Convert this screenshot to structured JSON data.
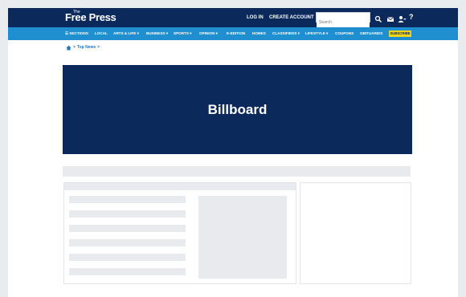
{
  "header": {
    "logo_small": "The",
    "logo_main": "Free Press",
    "login_label": "LOG IN",
    "create_account_label": "CREATE ACCOUNT",
    "search_placeholder": "Search",
    "icons": [
      "search-icon",
      "mail-icon",
      "user-icon",
      "help-icon"
    ],
    "help_glyph": "?"
  },
  "nav": {
    "items": [
      {
        "label": "☰ SECTIONS"
      },
      {
        "label": "LOCAL"
      },
      {
        "label": "ARTS & LIFE ▾"
      },
      {
        "label": "BUSINESS ▾"
      },
      {
        "label": "SPORTS ▾"
      },
      {
        "label": "OPINION ▾"
      },
      {
        "label": "E-EDITION"
      },
      {
        "label": "HOMES"
      },
      {
        "label": "CLASSIFIEDS ▾"
      },
      {
        "label": "LIFESTYLE ▾"
      },
      {
        "label": "COUPONS"
      },
      {
        "label": "OBITUARIES"
      }
    ],
    "subscribe_label": "SUBSCRIBE"
  },
  "breadcrumb": {
    "current": "Top News",
    "separator_after_home": ">",
    "separator_after_current": ">"
  },
  "billboard": {
    "label": "Billboard"
  },
  "colors": {
    "topbar": "#0b2a5b",
    "navbar": "#1f8fd0",
    "subscribe": "#f2d41c",
    "billboard": "#0b2a5b",
    "placeholder": "#e8eaed"
  }
}
